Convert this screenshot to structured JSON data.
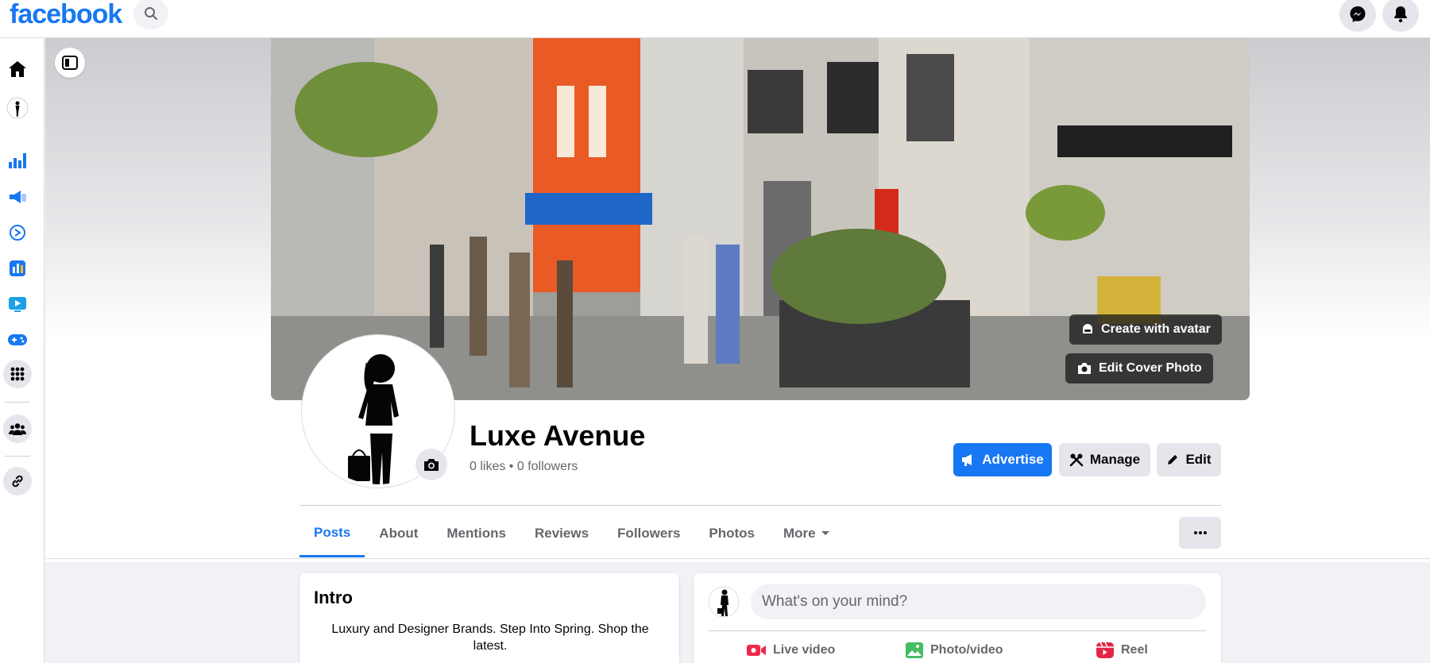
{
  "topbar": {
    "logo": "facebook"
  },
  "rail": {
    "items": [
      {
        "name": "home-icon"
      },
      {
        "name": "page-avatar-icon"
      },
      {
        "name": "insights-icon"
      },
      {
        "name": "ad-center-icon"
      },
      {
        "name": "meta-business-icon"
      },
      {
        "name": "creator-studio-icon"
      },
      {
        "name": "watch-icon"
      },
      {
        "name": "gaming-icon"
      },
      {
        "name": "menu-grid-icon"
      },
      {
        "name": "groups-icon"
      },
      {
        "name": "link-icon"
      }
    ]
  },
  "cover": {
    "create_avatar_label": "Create with avatar",
    "edit_cover_label": "Edit Cover Photo"
  },
  "profile": {
    "name": "Luxe Avenue",
    "stats": "0 likes • 0 followers"
  },
  "actions": {
    "advertise": "Advertise",
    "manage": "Manage",
    "edit": "Edit"
  },
  "tabs": [
    {
      "label": "Posts",
      "active": true
    },
    {
      "label": "About"
    },
    {
      "label": "Mentions"
    },
    {
      "label": "Reviews"
    },
    {
      "label": "Followers"
    },
    {
      "label": "Photos"
    },
    {
      "label": "More"
    }
  ],
  "intro": {
    "title": "Intro",
    "text": "Luxury and Designer Brands. Step Into Spring. Shop the latest."
  },
  "composer": {
    "placeholder": "What's on your mind?",
    "live_video": "Live video",
    "photo_video": "Photo/video",
    "reel": "Reel"
  },
  "colors": {
    "brand": "#1877f2",
    "live_red": "#f02849",
    "photo_green": "#45bd62",
    "reel_pink": "#e42645"
  }
}
